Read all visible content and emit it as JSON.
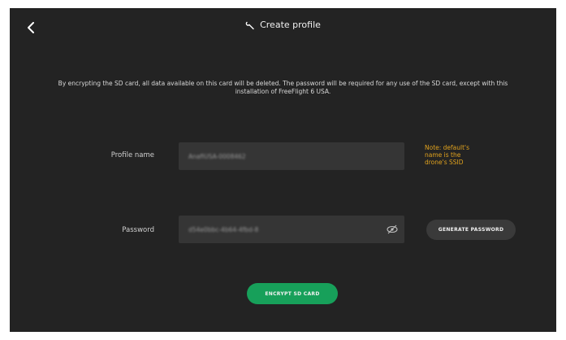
{
  "header": {
    "title": "Create profile",
    "icon": "wrench-icon"
  },
  "notice": {
    "text": "By encrypting the SD card, all data available on this card will be deleted. The password will be required for any use of the SD card, except with this installation of FreeFlight 6 USA."
  },
  "profile": {
    "label": "Profile name",
    "value": "AnafiUSA-0008462",
    "note": "Note: default's name is the drone's SSID"
  },
  "password": {
    "label": "Password",
    "value": "d54e0bbc-4b64-4fbd-8",
    "generate_label": "GENERATE PASSWORD"
  },
  "actions": {
    "encrypt_label": "ENCRYPT SD CARD"
  },
  "colors": {
    "background": "#232323",
    "accent": "#17a05a",
    "note": "#e0a21e",
    "field": "#353535"
  }
}
